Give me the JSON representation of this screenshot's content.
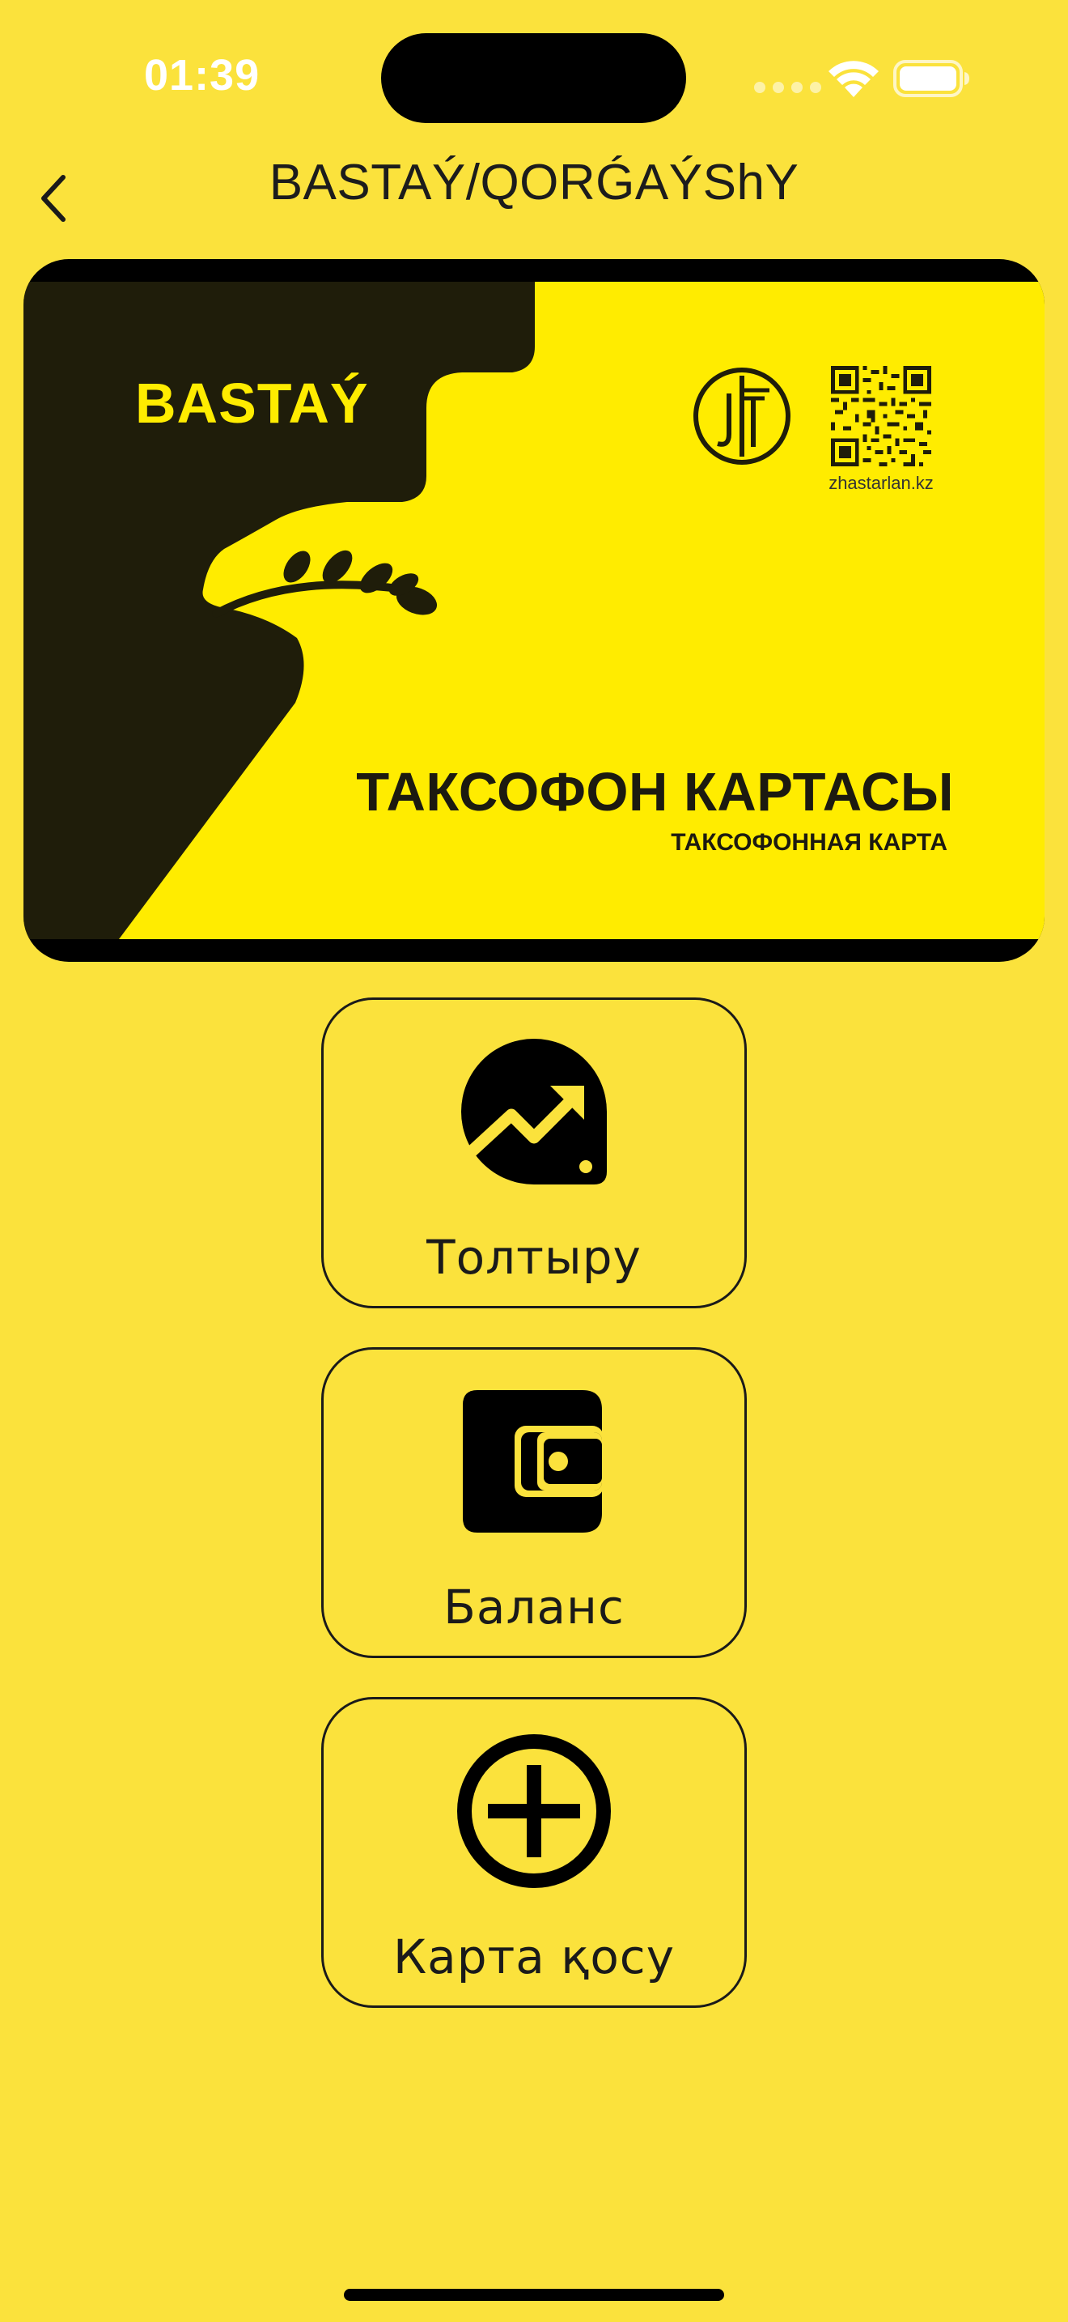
{
  "status_bar": {
    "time": "01:39"
  },
  "nav": {
    "title": "BASTAÝ/QORǴAÝShY",
    "back_icon": "chevron-left-icon"
  },
  "card": {
    "brand": "BASTAÝ",
    "website": "zhastarlan.kz",
    "title": "ТАКСОФОН КАРТАСЫ",
    "subtitle": "ТАКСОФОННАЯ КАРТА",
    "colors": {
      "face": "#FFEC00",
      "dark": "#1F1D0A",
      "border": "#000000"
    }
  },
  "actions": [
    {
      "label": "Толтыру",
      "icon": "wallet-trend-up-icon"
    },
    {
      "label": "Баланс",
      "icon": "wallet-icon"
    },
    {
      "label": "Карта қосу",
      "icon": "plus-circle-icon"
    }
  ],
  "colors": {
    "background": "#FBE23C",
    "text": "#1A1A1A"
  }
}
